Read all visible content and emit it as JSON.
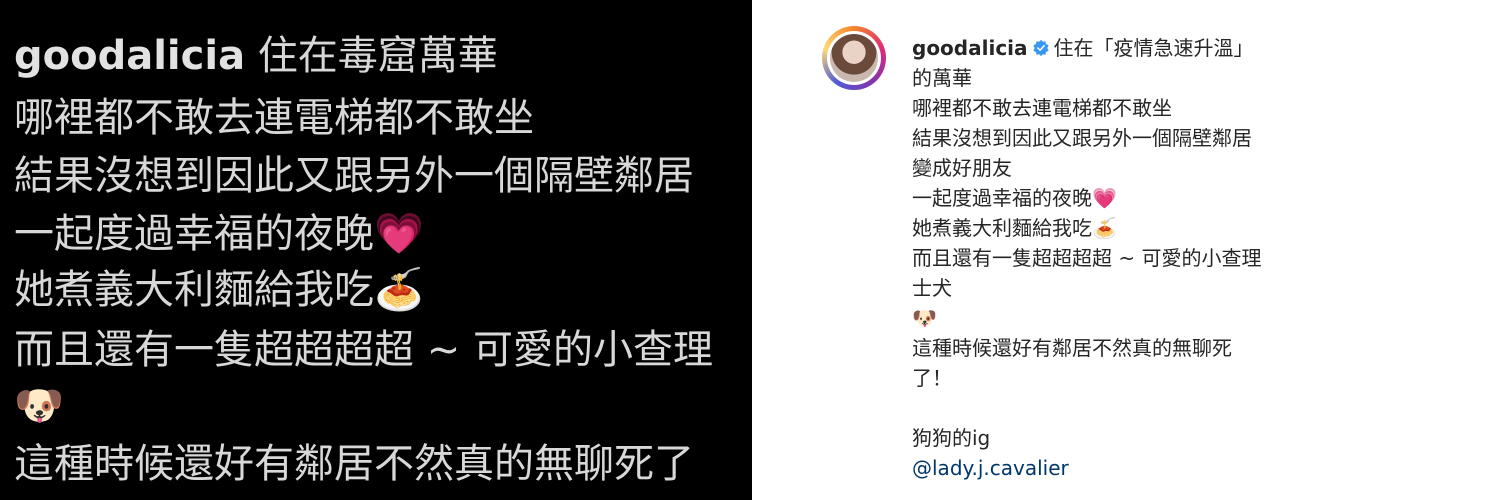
{
  "left": {
    "username": "goodalicia",
    "line1_rest": "住在毒窟萬華",
    "line2": "哪裡都不敢去連電梯都不敢坐",
    "line3": "結果沒想到因此又跟另外一個隔壁鄰居",
    "line4": "一起度過幸福的夜晚",
    "line5": "她煮義大利麵給我吃",
    "line6": "而且還有一隻超超超超 ~ 可愛的小查理",
    "line8": "這種時候還好有鄰居不然真的無聊死了",
    "heart_emoji": "💗",
    "pasta_emoji": "🍝",
    "dog_emoji": "🐶"
  },
  "right": {
    "username": "goodalicia",
    "verified_icon": "verified-badge-icon",
    "caption_line1": "住在「疫情急速升溫」",
    "caption_line2": "的萬華",
    "caption_line3": "哪裡都不敢去連電梯都不敢坐",
    "caption_line4": "結果沒想到因此又跟另外一個隔壁鄰居",
    "caption_line5": "變成好朋友",
    "caption_line6": "一起度過幸福的夜晚",
    "caption_line7": "她煮義大利麵給我吃",
    "caption_line8": "而且還有一隻超超超超 ~ 可愛的小查理",
    "caption_line9": "士犬",
    "caption_line11": "這種時候還好有鄰居不然真的無聊死",
    "caption_line12": "了！",
    "caption_line14": "狗狗的ig",
    "mention": "@lady.j.cavalier",
    "heart_emoji": "💗",
    "pasta_emoji": "🍝",
    "dog_emoji": "🐶",
    "colors": {
      "text": "#262626",
      "link": "#00376b",
      "verified": "#3897f0"
    }
  }
}
